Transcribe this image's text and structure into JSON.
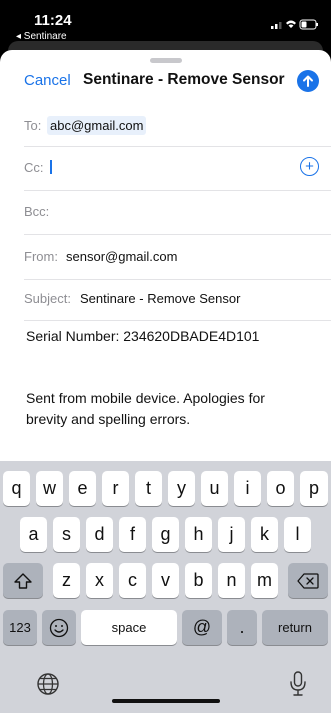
{
  "status_bar": {
    "time": "11:24",
    "back_app": "◂ Sentinare"
  },
  "compose": {
    "cancel_label": "Cancel",
    "title": "Sentinare - Remove Sensor",
    "to_label": "To:",
    "to_value": "abc@gmail.com",
    "cc_label": "Cc:",
    "bcc_label": "Bcc:",
    "from_label": "From:",
    "from_value": "sensor@gmail.com",
    "subject_label": "Subject:",
    "subject_value": "Sentinare - Remove Sensor",
    "body_line1": "Serial Number: 234620DBADE4D101",
    "signature_line1": "Sent from mobile device. Apologies for",
    "signature_line2": "brevity and spelling errors."
  },
  "keyboard": {
    "row1": [
      "q",
      "w",
      "e",
      "r",
      "t",
      "y",
      "u",
      "i",
      "o",
      "p"
    ],
    "row2": [
      "a",
      "s",
      "d",
      "f",
      "g",
      "h",
      "j",
      "k",
      "l"
    ],
    "row3": [
      "z",
      "x",
      "c",
      "v",
      "b",
      "n",
      "m"
    ],
    "numbers_key": "123",
    "space_key": "space",
    "at_key": "@",
    "dot_key": ".",
    "return_key": "return"
  },
  "colors": {
    "accent": "#1a73e8",
    "keyboard_bg": "#d1d3d9"
  }
}
